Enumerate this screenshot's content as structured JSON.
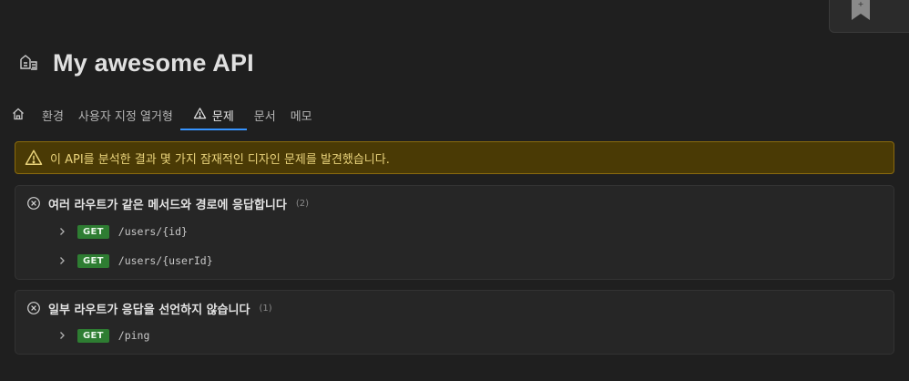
{
  "title": "My awesome API",
  "tabs": [
    {
      "label": "환경"
    },
    {
      "label": "사용자 지정 열거형"
    },
    {
      "label": "문제"
    },
    {
      "label": "문서"
    },
    {
      "label": "메모"
    }
  ],
  "warning": "이 API를 분석한 결과 몇 가지 잠재적인 디자인 문제를 발견했습니다.",
  "issues": [
    {
      "title": "여러 라우트가 같은 메서드와 경로에 응답합니다",
      "count": "(2)",
      "routes": [
        {
          "method": "GET",
          "path": "/users/{id}"
        },
        {
          "method": "GET",
          "path": "/users/{userId}"
        }
      ]
    },
    {
      "title": "일부 라우트가 응답을 선언하지 않습니다",
      "count": "(1)",
      "routes": [
        {
          "method": "GET",
          "path": "/ping"
        }
      ]
    }
  ],
  "colors": {
    "background": "#1f1f1f",
    "warning_bg": "#4a3a05",
    "warning_text": "#e8d27a",
    "get_badge": "#2e7d32",
    "active_tab": "#3794ff"
  },
  "icons": {
    "title": "api-icon",
    "home": "home-icon",
    "warning": "warning-icon",
    "error": "circle-x-icon",
    "expand": "chevron-right-icon",
    "corner": "bookmark-icon"
  }
}
